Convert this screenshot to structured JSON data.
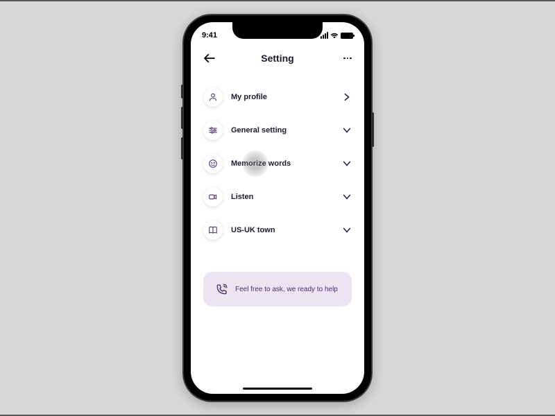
{
  "statusBar": {
    "time": "9:41"
  },
  "nav": {
    "title": "Setting"
  },
  "settings": {
    "items": [
      {
        "label": "My profile",
        "chevron": "right"
      },
      {
        "label": "General setting",
        "chevron": "down"
      },
      {
        "label": "Memorize words",
        "chevron": "down"
      },
      {
        "label": "Listen",
        "chevron": "down"
      },
      {
        "label": "US-UK town",
        "chevron": "down"
      }
    ]
  },
  "help": {
    "text": "Feel free to ask, we ready to help"
  },
  "colors": {
    "accent": "#4a3068",
    "helpBg": "#ede4f3",
    "chevron": "#2d2152"
  }
}
